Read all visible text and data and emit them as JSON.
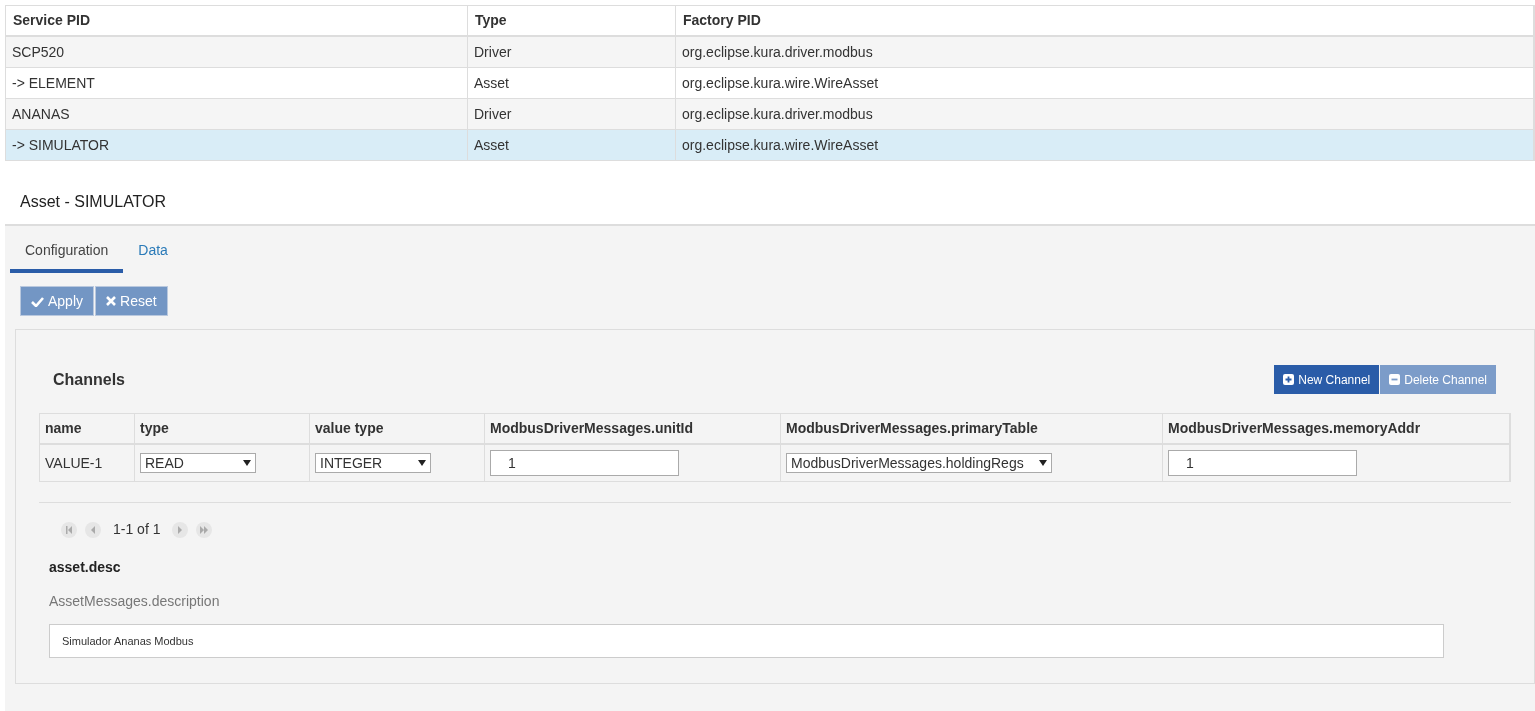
{
  "services": {
    "columns": [
      "Service PID",
      "Type",
      "Factory PID"
    ],
    "rows": [
      {
        "cells": [
          "SCP520",
          "Driver",
          "org.eclipse.kura.driver.modbus"
        ],
        "selected": false
      },
      {
        "cells": [
          "-> ELEMENT",
          "Asset",
          "org.eclipse.kura.wire.WireAsset"
        ],
        "selected": false
      },
      {
        "cells": [
          "ANANAS",
          "Driver",
          "org.eclipse.kura.driver.modbus"
        ],
        "selected": false
      },
      {
        "cells": [
          "-> SIMULATOR",
          "Asset",
          "org.eclipse.kura.wire.WireAsset"
        ],
        "selected": true
      }
    ]
  },
  "asset_title": "Asset - SIMULATOR",
  "tabs": [
    {
      "label": "Configuration",
      "selected": true
    },
    {
      "label": "Data",
      "selected": false
    }
  ],
  "actions": [
    {
      "label": "Apply",
      "kind": "check",
      "disabled": true
    },
    {
      "label": "Reset",
      "kind": "cross",
      "disabled": true
    }
  ],
  "channels": {
    "title": "Channels",
    "buttons": [
      {
        "label": "New Channel",
        "kind": "plus",
        "disabled": false
      },
      {
        "label": "Delete Channel",
        "kind": "minus",
        "disabled": true
      }
    ],
    "columns": [
      "name",
      "type",
      "value type",
      "ModbusDriverMessages.unitId",
      "ModbusDriverMessages.primaryTable",
      "ModbusDriverMessages.memoryAddr"
    ],
    "rows": [
      [
        {
          "kind": "text",
          "value": "VALUE-1"
        },
        {
          "kind": "select",
          "value": "READ"
        },
        {
          "kind": "select",
          "value": "INTEGER"
        },
        {
          "kind": "input",
          "value": "1"
        },
        {
          "kind": "select",
          "value": "ModbusDriverMessages.holdingRegs"
        },
        {
          "kind": "input",
          "value": "1"
        }
      ]
    ],
    "pager": "1-1 of 1"
  },
  "field": {
    "label": "asset.desc",
    "description": "AssetMessages.description",
    "value": "Simulador Ananas Modbus"
  }
}
